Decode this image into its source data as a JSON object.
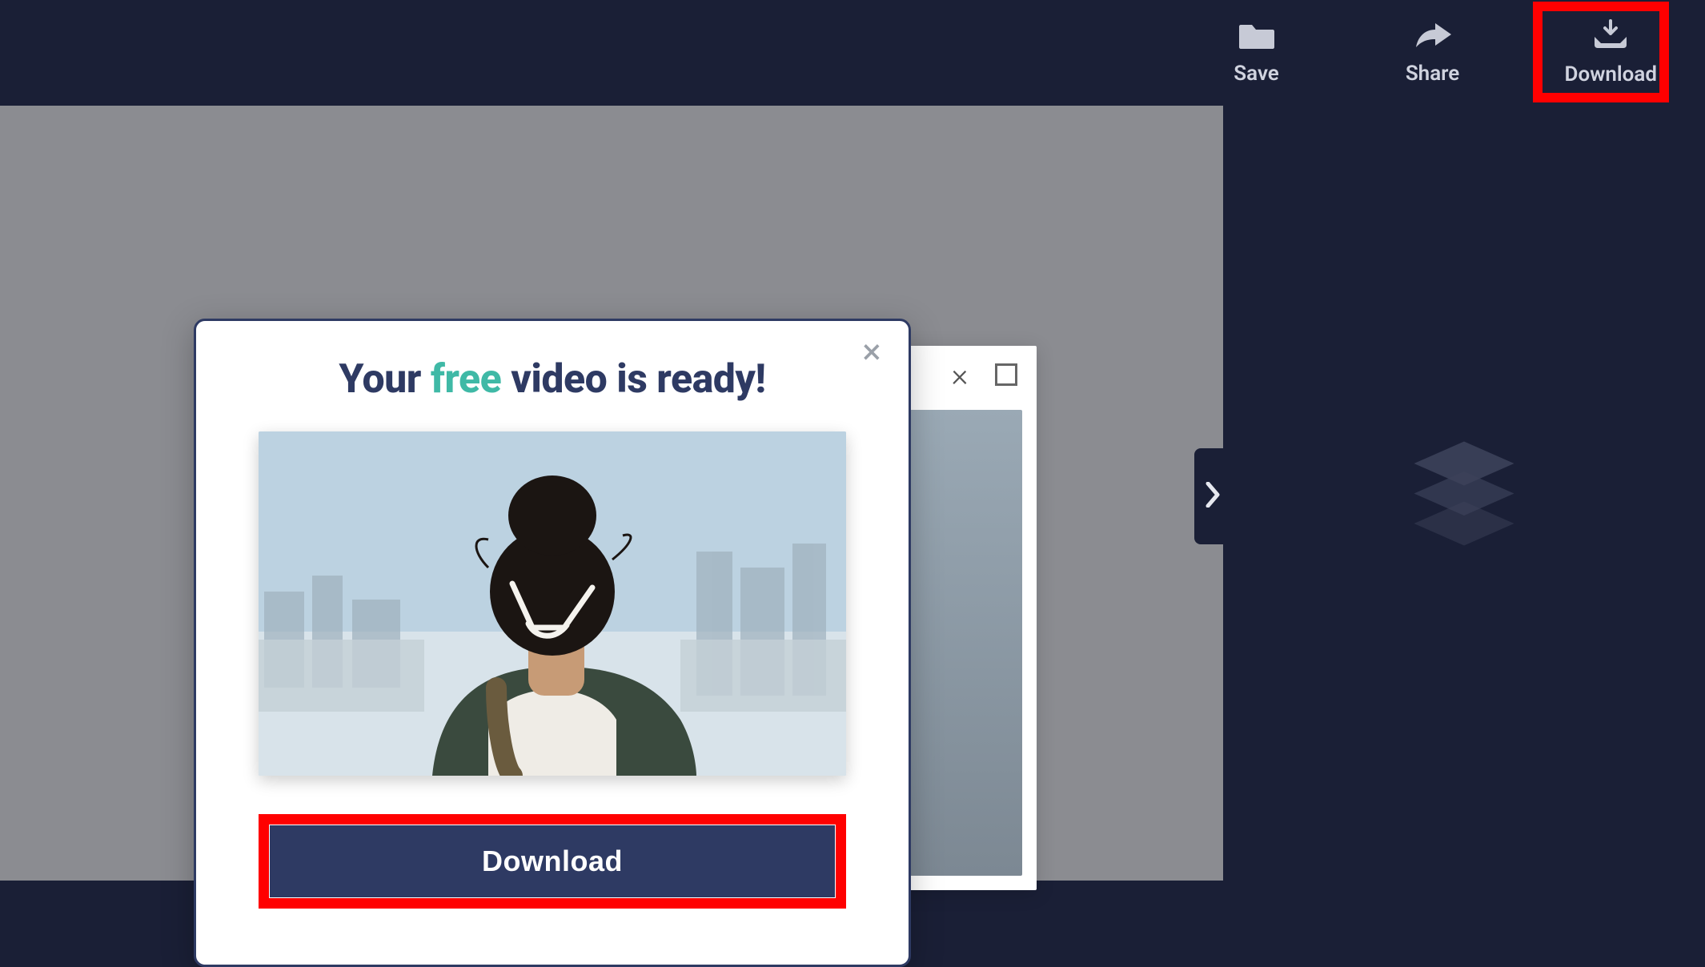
{
  "topbar": {
    "save_label": "Save",
    "share_label": "Share",
    "download_label": "Download"
  },
  "modal": {
    "title_pre": "Your ",
    "title_emph": "free",
    "title_post": " video is ready!",
    "download_button": "Download",
    "close_glyph": "×"
  },
  "editor_window": {
    "close_glyph": "×"
  },
  "icons": {
    "save": "folder-icon",
    "share": "share-arrow-icon",
    "download": "download-tray-icon",
    "layers": "layers-icon",
    "chevron_right": "chevron-right-icon"
  },
  "highlights": {
    "download_topbar": true,
    "download_modal": true
  }
}
